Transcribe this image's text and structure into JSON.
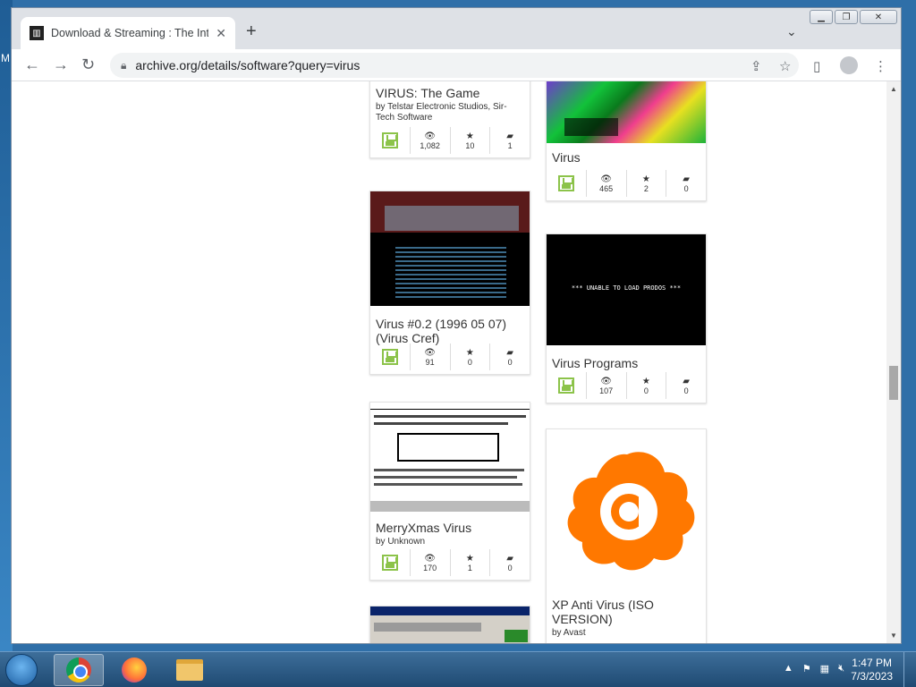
{
  "browser": {
    "tab_title": "Download & Streaming : The Internet Archive",
    "tab_close": "✕",
    "new_tab": "+",
    "url": "archive.org/details/software?query=virus"
  },
  "results": [
    {
      "title": "VIRUS: The Game",
      "by": "by Telstar Electronic Studios, Sir-Tech Software",
      "views": "1,082",
      "favorites": "10",
      "reviews": "1"
    },
    {
      "title": "Virus",
      "by": "",
      "views": "465",
      "favorites": "2",
      "reviews": "0"
    },
    {
      "title": "Virus #0.2 (1996 05 07) (Virus Cref)",
      "by": "",
      "views": "91",
      "favorites": "0",
      "reviews": "0"
    },
    {
      "title": "Virus Programs",
      "by": "",
      "views": "107",
      "favorites": "0",
      "reviews": "0",
      "screen_text": "*** UNABLE TO LOAD PRODOS ***"
    },
    {
      "title": "MerryXmas Virus",
      "by": "by Unknown",
      "views": "170",
      "favorites": "1",
      "reviews": "0"
    },
    {
      "title": "XP Anti Virus (ISO VERSION)",
      "by": "by Avast",
      "logo_letter": "a"
    }
  ],
  "icons": {
    "views": "eye-icon",
    "favorites": "star-icon",
    "reviews": "comment-icon",
    "mediatype": "software-disk-icon"
  },
  "colors": {
    "disk_icon": "#8cc34a",
    "avast_orange": "#ff7800"
  },
  "taskbar": {
    "time": "1:47 PM",
    "date": "7/3/2023"
  }
}
